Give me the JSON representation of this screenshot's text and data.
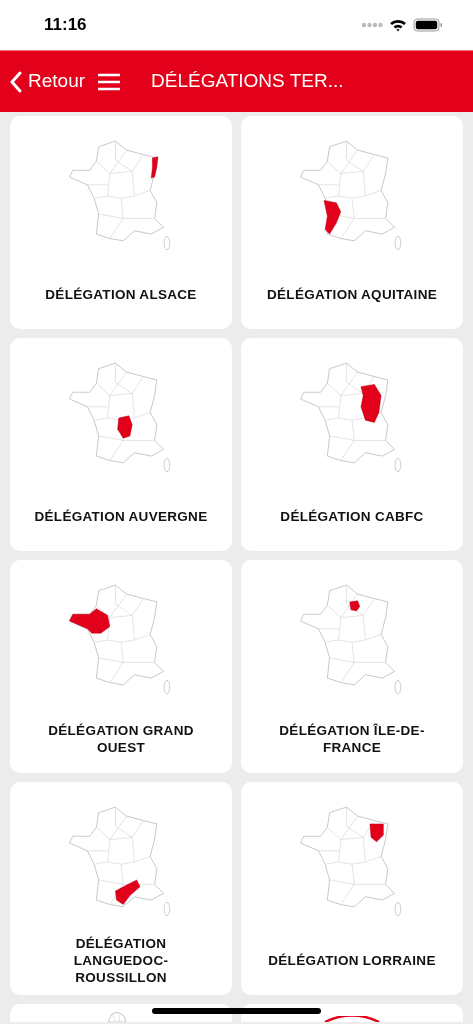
{
  "status_bar": {
    "time": "11:16"
  },
  "nav_bar": {
    "back_label": "Retour",
    "title": "DÉLÉGATIONS TER..."
  },
  "cards": [
    {
      "label": "DÉLÉGATION ALSACE",
      "kind": "alsace"
    },
    {
      "label": "DÉLÉGATION AQUITAINE",
      "kind": "aquitaine"
    },
    {
      "label": "DÉLÉGATION AUVERGNE",
      "kind": "auvergne"
    },
    {
      "label": "DÉLÉGATION CABFC",
      "kind": "cabfc"
    },
    {
      "label": "DÉLÉGATION GRAND OUEST",
      "kind": "ouest"
    },
    {
      "label": "DÉLÉGATION ÎLE-DE-FRANCE",
      "kind": "idf"
    },
    {
      "label": "DÉLÉGATION LANGUEDOC-ROUSSILLON",
      "kind": "languedoc"
    },
    {
      "label": "DÉLÉGATION LORRAINE",
      "kind": "lorraine"
    },
    {
      "kind": "map"
    },
    {
      "kind": "logo"
    }
  ]
}
